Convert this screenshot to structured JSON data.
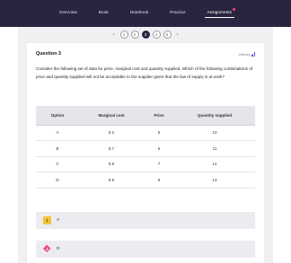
{
  "nav": {
    "tabs": [
      {
        "label": "Overview"
      },
      {
        "label": "Book"
      },
      {
        "label": "Notebook"
      },
      {
        "label": "Practice"
      },
      {
        "label": "Assignments"
      }
    ],
    "active_tab": "Assignments"
  },
  "pager": {
    "prev_glyph": "‹",
    "next_glyph": "›",
    "pages": [
      "1",
      "2",
      "3",
      "4",
      "5"
    ],
    "current_page": "3"
  },
  "question": {
    "title": "Question 3",
    "brand": "Difficulty",
    "prompt": "Consider the following set of data for price, marginal cost and quantity supplied. Which of the following combinations of price and quantity supplied will not be acceptable to the supplier given that the law of supply is at work?"
  },
  "table": {
    "headers": [
      "Option",
      "Marginal cost",
      "Price",
      "Quantity supplied"
    ],
    "rows": [
      [
        "A",
        "5.2",
        "5",
        "10"
      ],
      [
        "B",
        "5.7",
        "6",
        "11"
      ],
      [
        "C",
        "5.9",
        "7",
        "12"
      ],
      [
        "D",
        "6.5",
        "8",
        "13"
      ]
    ]
  },
  "answers": [
    {
      "badge": "1",
      "letter": "A",
      "badge_color": "#f4c33a"
    },
    {
      "badge": "2",
      "letter": "D",
      "badge_color": "#e8497c"
    }
  ],
  "colors": {
    "topbar": "#2b2440",
    "accent_pink": "#e8497c",
    "accent_yellow": "#f4c33a",
    "content_bg": "#f0f0f3"
  }
}
